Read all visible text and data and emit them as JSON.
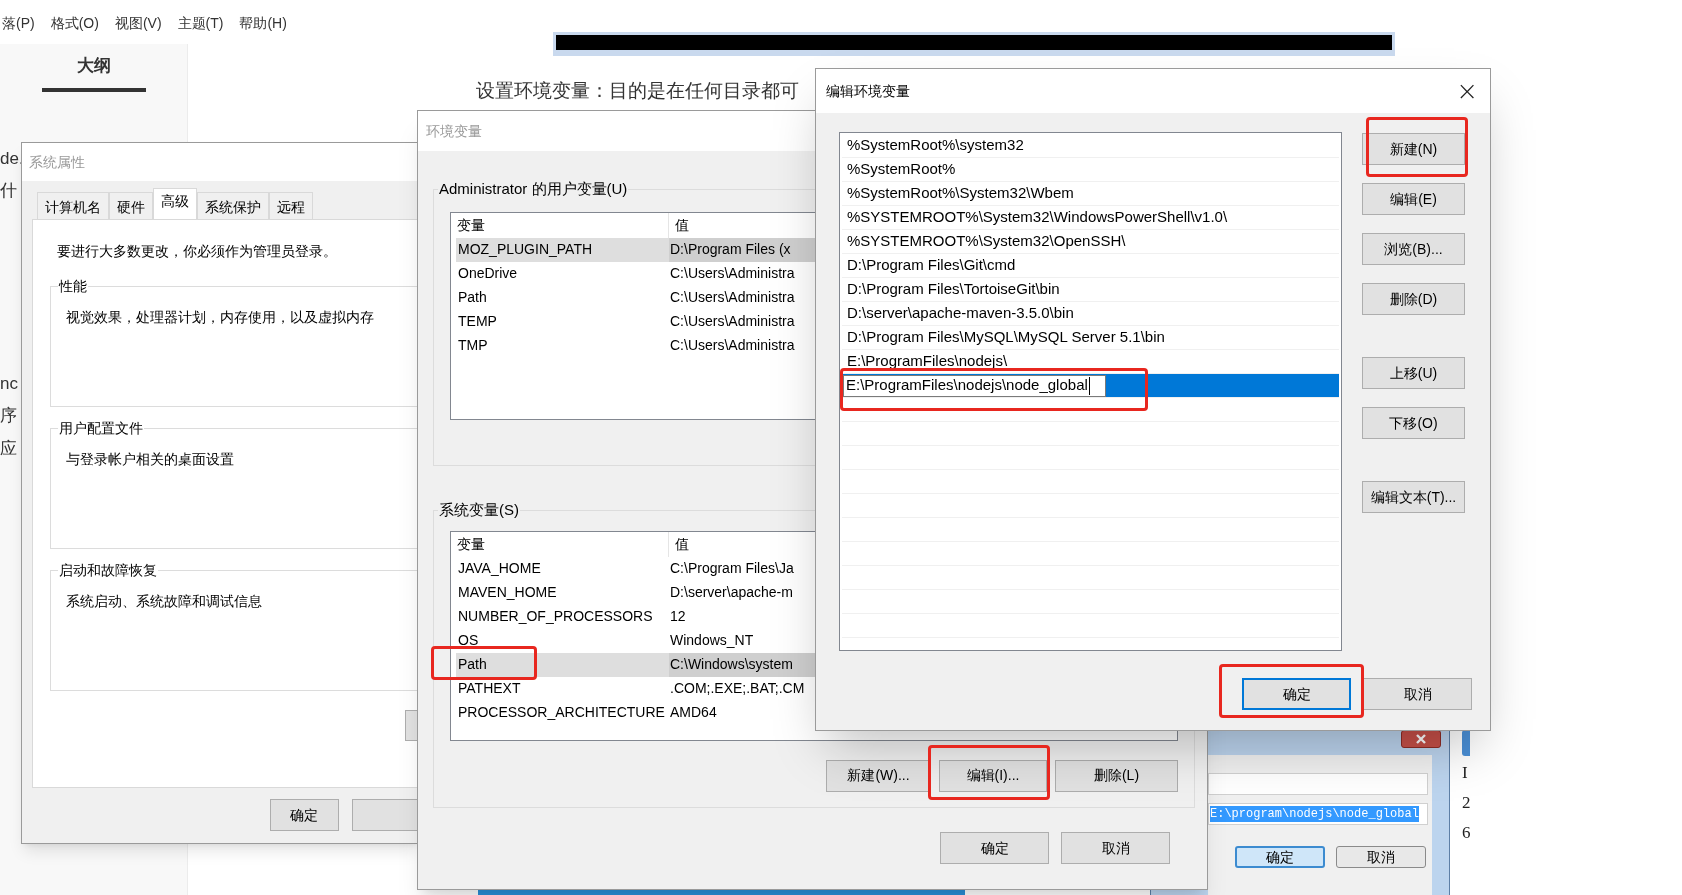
{
  "editor": {
    "menu": [
      "落(P)",
      "格式(O)",
      "视图(V)",
      "主题(T)",
      "帮助(H)"
    ],
    "sidebar_tab": "大纲",
    "margin_texts": [
      "de.",
      "什",
      "nc",
      "序",
      "应"
    ],
    "heading": "设置环境变量：目的是在任何目录都可",
    "right_texts": [
      "I",
      "2",
      "6"
    ]
  },
  "system_properties": {
    "title": "系统属性",
    "tabs": [
      {
        "label": "计算机名",
        "selected": false
      },
      {
        "label": "硬件",
        "selected": false
      },
      {
        "label": "高级",
        "selected": true
      },
      {
        "label": "系统保护",
        "selected": false
      },
      {
        "label": "远程",
        "selected": false
      }
    ],
    "notice": "要进行大多数更改，你必须作为管理员登录。",
    "groups": [
      {
        "title": "性能",
        "text": "视觉效果，处理器计划，内存使用，以及虚拟内存"
      },
      {
        "title": "用户配置文件",
        "text": "与登录帐户相关的桌面设置"
      },
      {
        "title": "启动和故障恢复",
        "text": "系统启动、系统故障和调试信息"
      }
    ],
    "buttons": [
      "确定"
    ]
  },
  "environment_variables": {
    "title": "环境变量",
    "user_group": "Administrator 的用户变量(U)",
    "user_table": {
      "columns": [
        "变量",
        "值"
      ],
      "rows": [
        {
          "name": "MOZ_PLUGIN_PATH",
          "value": "D:\\Program Files (x",
          "selected": true
        },
        {
          "name": "OneDrive",
          "value": "C:\\Users\\Administra",
          "selected": false
        },
        {
          "name": "Path",
          "value": "C:\\Users\\Administra",
          "selected": false
        },
        {
          "name": "TEMP",
          "value": "C:\\Users\\Administra",
          "selected": false
        },
        {
          "name": "TMP",
          "value": "C:\\Users\\Administra",
          "selected": false
        }
      ]
    },
    "system_group": "系统变量(S)",
    "system_table": {
      "columns": [
        "变量",
        "值"
      ],
      "rows": [
        {
          "name": "JAVA_HOME",
          "value": "C:\\Program Files\\Ja",
          "selected": false
        },
        {
          "name": "MAVEN_HOME",
          "value": "D:\\server\\apache-m",
          "selected": false
        },
        {
          "name": "NUMBER_OF_PROCESSORS",
          "value": "12",
          "selected": false
        },
        {
          "name": "OS",
          "value": "Windows_NT",
          "selected": false
        },
        {
          "name": "Path",
          "value": "C:\\Windows\\system",
          "selected": true
        },
        {
          "name": "PATHEXT",
          "value": ".COM;.EXE;.BAT;.CM",
          "selected": false
        },
        {
          "name": "PROCESSOR_ARCHITECTURE",
          "value": "AMD64",
          "selected": false
        }
      ]
    },
    "table_buttons": [
      "新建(W)...",
      "编辑(I)...",
      "删除(L)"
    ],
    "buttons": [
      "确定",
      "取消"
    ]
  },
  "edit_dialog": {
    "title": "编辑环境变量",
    "close": "×",
    "entries": [
      {
        "text": "%SystemRoot%\\system32",
        "selected": false
      },
      {
        "text": "%SystemRoot%",
        "selected": false
      },
      {
        "text": "%SystemRoot%\\System32\\Wbem",
        "selected": false
      },
      {
        "text": "%SYSTEMROOT%\\System32\\WindowsPowerShell\\v1.0\\",
        "selected": false
      },
      {
        "text": "%SYSTEMROOT%\\System32\\OpenSSH\\",
        "selected": false
      },
      {
        "text": "D:\\Program Files\\Git\\cmd",
        "selected": false
      },
      {
        "text": "D:\\Program Files\\TortoiseGit\\bin",
        "selected": false
      },
      {
        "text": "D:\\server\\apache-maven-3.5.0\\bin",
        "selected": false
      },
      {
        "text": "D:\\Program Files\\MySQL\\MySQL Server 5.1\\bin",
        "selected": false
      },
      {
        "text": "E:\\ProgramFiles\\nodejs\\",
        "selected": false
      },
      {
        "text": "E:\\ProgramFiles\\nodejs\\node_global",
        "selected": true
      }
    ],
    "side_buttons": [
      "新建(N)",
      "编辑(E)",
      "浏览(B)...",
      "删除(D)",
      "上移(U)",
      "下移(O)",
      "编辑文本(T)..."
    ],
    "buttons": [
      {
        "label": "确定",
        "default": true
      },
      {
        "label": "取消",
        "default": false
      }
    ]
  },
  "old_dialog": {
    "path_value": "E:\\program\\nodejs\\node_global",
    "buttons": [
      {
        "label": "确定",
        "default": true
      },
      {
        "label": "取消",
        "default": false
      }
    ]
  }
}
